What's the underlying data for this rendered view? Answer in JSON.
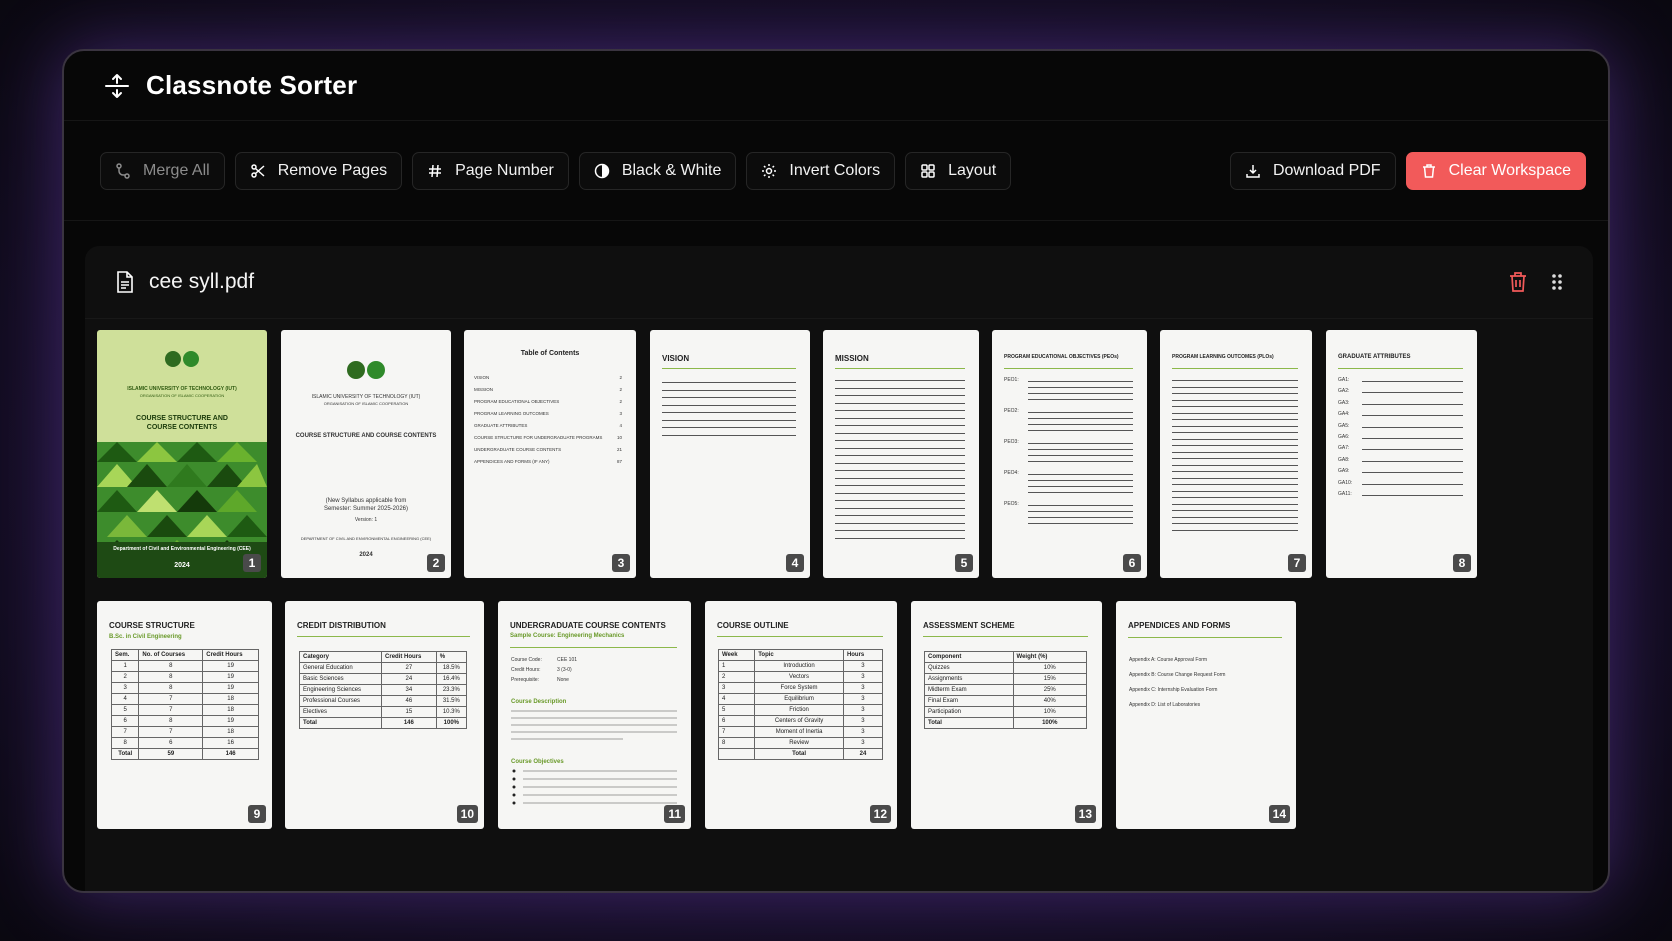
{
  "app": {
    "title": "Classnote Sorter"
  },
  "toolbar": {
    "merge_all": "Merge All",
    "remove_pages": "Remove Pages",
    "page_number": "Page Number",
    "black_white": "Black & White",
    "invert_colors": "Invert Colors",
    "layout": "Layout",
    "download_pdf": "Download PDF",
    "clear_workspace": "Clear Workspace"
  },
  "file": {
    "name": "cee syll.pdf"
  },
  "colors": {
    "accent_red": "#f25a5a",
    "cover_green": "#cfe09a",
    "rule_green": "#8cb84a"
  },
  "pages": [
    {
      "num": "1",
      "cover": {
        "univ1": "ISLAMIC UNIVERSITY OF TECHNOLOGY (IUT)",
        "org1": "ORGANISATION OF ISLAMIC COOPERATION",
        "title": "COURSE STRUCTURE AND COURSE CONTENTS",
        "dept": "Department of Civil and Environmental Engineering (CEE)",
        "year": "2024"
      }
    },
    {
      "num": "2",
      "cover": {
        "univ": "ISLAMIC UNIVERSITY OF TECHNOLOGY (IUT)",
        "org": "ORGANISATION OF ISLAMIC COOPERATION",
        "title": "COURSE STRUCTURE AND COURSE CONTENTS",
        "syll1": "(New Syllabus applicable from",
        "syll2": "Semester: Summer 2025-2026)",
        "version": "Version: 1",
        "dept": "DEPARTMENT OF CIVIL AND ENVIRONMENTAL ENGINEERING (CEE)",
        "year": "2024"
      }
    },
    {
      "num": "3",
      "heading": "Table of Contents",
      "toc": [
        {
          "t": "VISION",
          "p": "2"
        },
        {
          "t": "MISSION",
          "p": "2"
        },
        {
          "t": "PROGRAM EDUCATIONAL OBJECTIVES",
          "p": "2"
        },
        {
          "t": "PROGRAM LEARNING OUTCOMES",
          "p": "3"
        },
        {
          "t": "GRADUATE ATTRIBUTES",
          "p": "4"
        },
        {
          "t": "COURSE STRUCTURE FOR UNDERGRADUATE PROGRAMS",
          "p": "10"
        },
        {
          "t": "UNDERGRADUATE COURSE CONTENTS",
          "p": "21"
        },
        {
          "t": "APPENDICES AND FORMS (IF ANY)",
          "p": "87"
        }
      ]
    },
    {
      "num": "4",
      "heading": "VISION"
    },
    {
      "num": "5",
      "heading": "MISSION"
    },
    {
      "num": "6",
      "heading": "PROGRAM EDUCATIONAL OBJECTIVES (PEOs)",
      "items": [
        "PEO1:",
        "PEO2:",
        "PEO3:",
        "PEO4:",
        "PEO5:"
      ]
    },
    {
      "num": "7",
      "heading": "PROGRAM LEARNING OUTCOMES (PLOs)"
    },
    {
      "num": "8",
      "heading": "GRADUATE ATTRIBUTES",
      "items": [
        "GA1:",
        "GA2:",
        "GA3:",
        "GA4:",
        "GA5:",
        "GA6:",
        "GA7:",
        "GA8:",
        "GA9:",
        "GA10:",
        "GA11:"
      ]
    },
    {
      "num": "9",
      "heading": "COURSE STRUCTURE",
      "subheading": "B.Sc. in Civil Engineering",
      "columns": [
        "Sem.",
        "No. of Courses",
        "Credit Hours"
      ],
      "rows": [
        [
          "1",
          "8",
          "19"
        ],
        [
          "2",
          "8",
          "19"
        ],
        [
          "3",
          "8",
          "19"
        ],
        [
          "4",
          "7",
          "18"
        ],
        [
          "5",
          "7",
          "18"
        ],
        [
          "6",
          "8",
          "19"
        ],
        [
          "7",
          "7",
          "18"
        ],
        [
          "8",
          "6",
          "16"
        ],
        [
          "Total",
          "59",
          "146"
        ]
      ]
    },
    {
      "num": "10",
      "heading": "CREDIT DISTRIBUTION",
      "columns": [
        "Category",
        "Credit Hours",
        "%"
      ],
      "rows": [
        [
          "General Education",
          "27",
          "18.5%"
        ],
        [
          "Basic Sciences",
          "24",
          "16.4%"
        ],
        [
          "Engineering Sciences",
          "34",
          "23.3%"
        ],
        [
          "Professional Courses",
          "46",
          "31.5%"
        ],
        [
          "Electives",
          "15",
          "10.3%"
        ],
        [
          "Total",
          "146",
          "100%"
        ]
      ]
    },
    {
      "num": "11",
      "heading": "UNDERGRADUATE COURSE CONTENTS",
      "subheading": "Sample Course: Engineering Mechanics",
      "fields": [
        {
          "k": "Course Code:",
          "v": "CEE 101"
        },
        {
          "k": "Credit Hours:",
          "v": "3 (3-0)"
        },
        {
          "k": "Prerequisite:",
          "v": "None"
        }
      ],
      "desc": "Course Description",
      "obj": "Course Objectives"
    },
    {
      "num": "12",
      "heading": "COURSE OUTLINE",
      "columns": [
        "Week",
        "Topic",
        "Hours"
      ],
      "rows": [
        [
          "1",
          "Introduction",
          "3"
        ],
        [
          "2",
          "Vectors",
          "3"
        ],
        [
          "3",
          "Force System",
          "3"
        ],
        [
          "4",
          "Equilibrium",
          "3"
        ],
        [
          "5",
          "Friction",
          "3"
        ],
        [
          "6",
          "Centers of Gravity",
          "3"
        ],
        [
          "7",
          "Moment of Inertia",
          "3"
        ],
        [
          "8",
          "Review",
          "3"
        ],
        [
          "",
          "Total",
          "24"
        ]
      ]
    },
    {
      "num": "13",
      "heading": "ASSESSMENT SCHEME",
      "columns": [
        "Component",
        "Weight (%)"
      ],
      "rows": [
        [
          "Quizzes",
          "10%"
        ],
        [
          "Assignments",
          "15%"
        ],
        [
          "Midterm Exam",
          "25%"
        ],
        [
          "Final Exam",
          "40%"
        ],
        [
          "Participation",
          "10%"
        ],
        [
          "Total",
          "100%"
        ]
      ]
    },
    {
      "num": "14",
      "heading": "APPENDICES AND FORMS",
      "items": [
        "Appendix A: Course Approval Form",
        "Appendix B: Course Change Request Form",
        "Appendix C: Internship Evaluation Form",
        "Appendix D: List of Laboratories"
      ]
    }
  ]
}
